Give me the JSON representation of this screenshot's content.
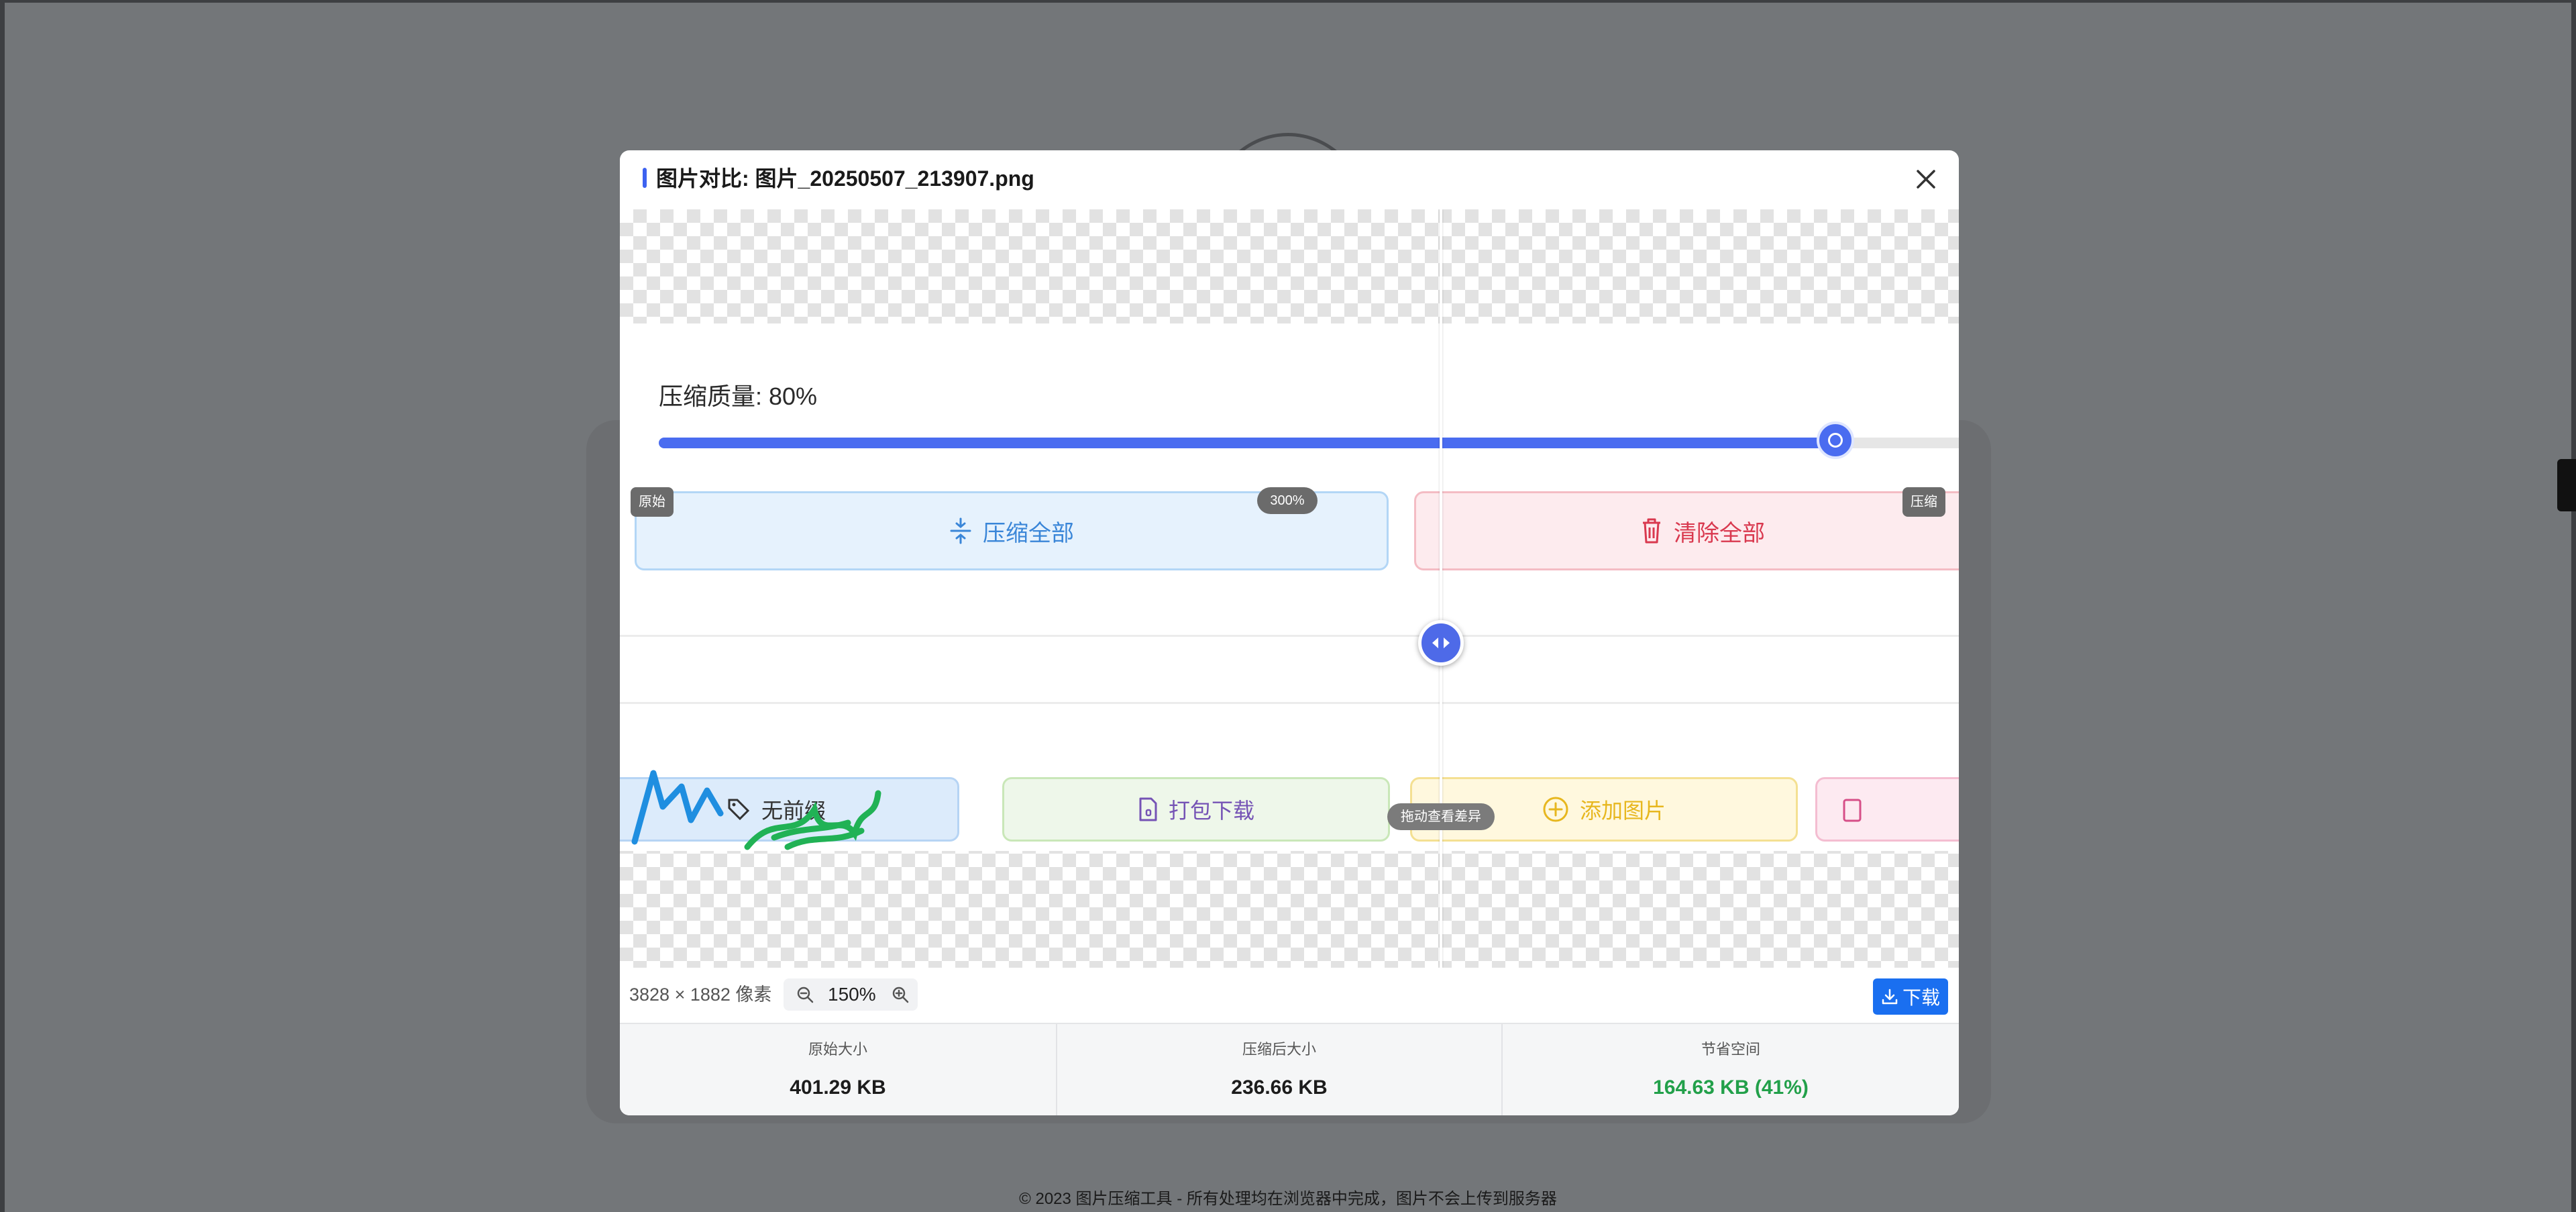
{
  "background": {
    "footer_text": "© 2023 图片压缩工具 - 所有处理均在浏览器中完成，图片不会上传到服务器"
  },
  "modal": {
    "title": "图片对比: 图片_20250507_213907.png",
    "accent_color": "#3d62f0"
  },
  "viewer": {
    "original_tag": "原始",
    "compressed_tag": "压缩",
    "zoom_badge": "300%",
    "drag_hint": "拖动查看差异",
    "divider_position": 0.615
  },
  "screenshot_content": {
    "quality_label": "压缩质量: 80%",
    "quality_value": 0.8,
    "compress_all": "压缩全部",
    "clear_all": "清除全部",
    "prev_partial": "无前缀",
    "download_zip": "打包下载",
    "add_image": "添加图片"
  },
  "toolbar": {
    "dimensions": "3828 × 1882 像素",
    "zoom_level": "150%",
    "download_label": "下载"
  },
  "stats": {
    "original_label": "原始大小",
    "original_value": "401.29 KB",
    "compressed_label": "压缩后大小",
    "compressed_value": "236.66 KB",
    "saved_label": "节省空间",
    "saved_value": "164.63 KB (41%)",
    "saved_color": "#22a04a"
  }
}
